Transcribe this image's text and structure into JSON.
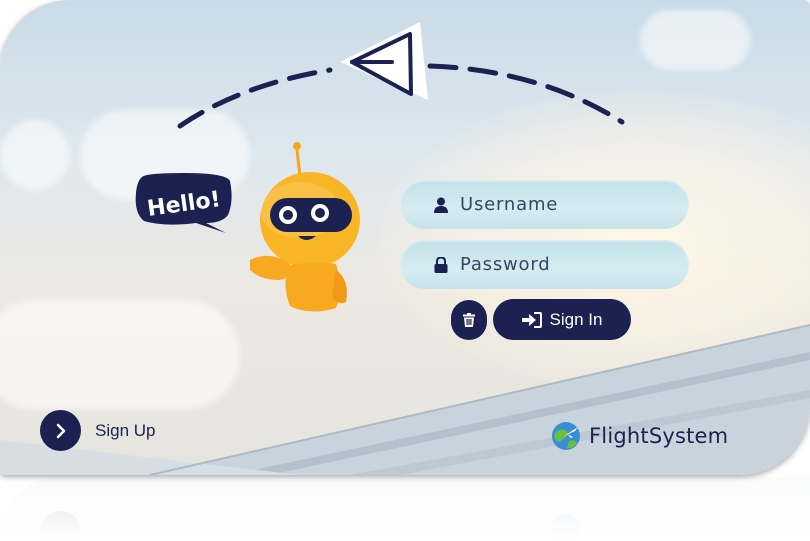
{
  "login": {
    "username_placeholder": "Username",
    "password_placeholder": "Password",
    "signin_label": "Sign In",
    "signup_label": "Sign Up"
  },
  "mascot": {
    "speech_text": "Hello!"
  },
  "brand": {
    "name": "FlightSystem"
  },
  "icons": {
    "username": "user-icon",
    "password": "lock-icon",
    "clear": "trash-icon",
    "signin": "sign-in-icon",
    "signup": "chevron-right-icon",
    "logo": "globe-plane-icon",
    "decoration": "paper-plane-icon"
  },
  "colors": {
    "primary": "#1b2150",
    "input_bg": "#cde6ee",
    "robot": "#f8b525"
  }
}
